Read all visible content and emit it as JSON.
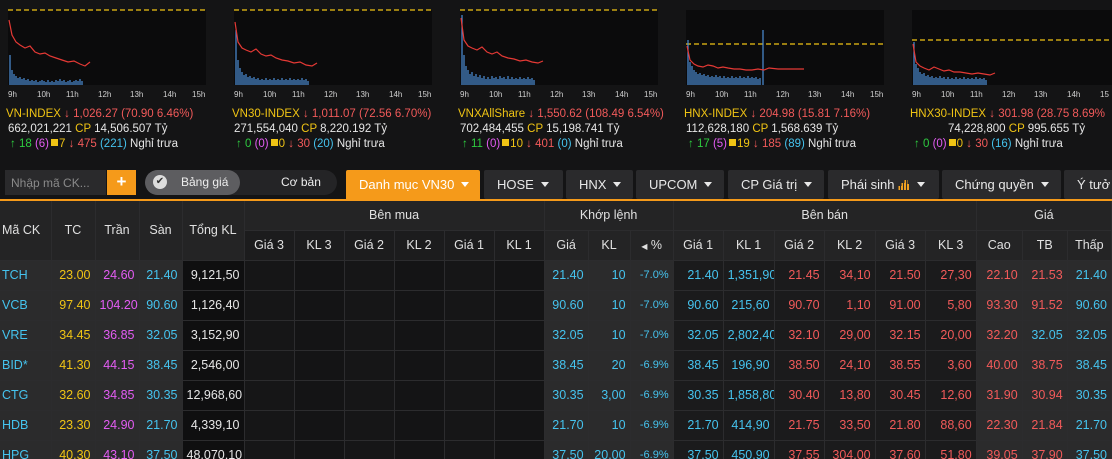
{
  "indices": [
    {
      "name": "VN-INDEX",
      "value": "1,026.27",
      "change": "(70.90 6.46%)",
      "vol": "662,021,221",
      "cp_label": "CP",
      "cp_value": "14,506.507 Tỷ",
      "up": "18",
      "up_ceil": "(6)",
      "ref": "7",
      "down": "475",
      "down_floor": "(221)",
      "status": "Nghỉ trưa"
    },
    {
      "name": "VN30-INDEX",
      "value": "1,011.07",
      "change": "(72.56 6.70%)",
      "vol": "271,554,040",
      "cp_label": "CP",
      "cp_value": "8,220.192 Tỷ",
      "up": "0",
      "up_ceil": "(0)",
      "ref": "0",
      "down": "30",
      "down_floor": "(20)",
      "status": "Nghỉ trưa"
    },
    {
      "name": "VNXAllShare",
      "value": "1,550.62",
      "change": "(108.49 6.54%)",
      "vol": "702,484,455",
      "cp_label": "CP",
      "cp_value": "15,198.741 Tỷ",
      "up": "11",
      "up_ceil": "(0)",
      "ref": "10",
      "down": "401",
      "down_floor": "(0)",
      "status": "Nghỉ trưa"
    },
    {
      "name": "HNX-INDEX",
      "value": "204.98",
      "change": "(15.81 7.16%)",
      "vol": "112,628,180",
      "cp_label": "CP",
      "cp_value": "1,568.639 Tỷ",
      "up": "17",
      "up_ceil": "(5)",
      "ref": "19",
      "down": "185",
      "down_floor": "(89)",
      "status": "Nghỉ trưa"
    },
    {
      "name": "HNX30-INDEX",
      "value": "301.98",
      "change": "(28.75 8.69%",
      "vol": "74,228,800",
      "cp_label": "CP",
      "cp_value": "995.655 Tỷ",
      "up": "0",
      "up_ceil": "(0)",
      "ref": "0",
      "down": "30",
      "down_floor": "(16)",
      "status": "Nghỉ trưa"
    }
  ],
  "chart_axis": [
    "9h",
    "10h",
    "11h",
    "12h",
    "13h",
    "14h",
    "15h"
  ],
  "chart_axis_short": [
    "9h",
    "10h",
    "11h",
    "12h",
    "13h",
    "14h",
    "15"
  ],
  "toolbar": {
    "search_placeholder": "Nhập mã CK...",
    "add_label": "+",
    "toggle_on": "Bảng giá",
    "toggle_off": "Cơ bản",
    "tabs": [
      "Danh mục VN30",
      "HOSE",
      "HNX",
      "UPCOM",
      "CP Giá trị",
      "Phái sinh",
      "Chứng quyền",
      "Ý tưở"
    ]
  },
  "colors": {
    "accent": "#f59a1a",
    "up": "#2ecc40",
    "down": "#f25a5a",
    "ref": "#f0c414",
    "ceil": "#e35cf3",
    "floor": "#45c3ee"
  },
  "table": {
    "groups": {
      "ben_mua": "Bên mua",
      "khop_lenh": "Khớp lệnh",
      "ben_ban": "Bên bán",
      "gia": "Giá"
    },
    "headers": {
      "ma_ck": "Mã CK",
      "tc": "TC",
      "tran": "Trần",
      "san": "Sàn",
      "tong_kl": "Tổng KL",
      "gia3": "Giá 3",
      "kl3": "KL 3",
      "gia2": "Giá 2",
      "kl2": "KL 2",
      "gia1": "Giá 1",
      "kl1": "KL 1",
      "khop_gia": "Giá",
      "khop_kl": "KL",
      "khop_pct": "%",
      "ban_gia1": "Giá 1",
      "ban_kl1": "KL 1",
      "ban_gia2": "Giá 2",
      "ban_kl2": "KL 2",
      "ban_gia3": "Giá 3",
      "ban_kl3": "KL 3",
      "cao": "Cao",
      "tb": "TB",
      "thap": "Thấp"
    },
    "rows": [
      {
        "sym": "TCH",
        "tc": "23.00",
        "tran": "24.60",
        "san": "21.40",
        "tong": "9,121,50",
        "kg": "21.40",
        "kkl": "10",
        "kp": "-7.0%",
        "b1": "21.40",
        "bk1": "1,351,90",
        "b2": "21.45",
        "bk2": "34,10",
        "b3": "21.50",
        "bk3": "27,30",
        "cao": "22.10",
        "tb": "21.53",
        "thap": "21.40",
        "c": {
          "sym": "floor",
          "kg": "floor",
          "b1": "floor",
          "b2": "down",
          "b3": "down",
          "cao": "down",
          "tb": "down",
          "thap": "floor"
        }
      },
      {
        "sym": "VCB",
        "tc": "97.40",
        "tran": "104.20",
        "san": "90.60",
        "tong": "1,126,40",
        "kg": "90.60",
        "kkl": "10",
        "kp": "-7.0%",
        "b1": "90.60",
        "bk1": "215,60",
        "b2": "90.70",
        "bk2": "1,10",
        "b3": "91.00",
        "bk3": "5,80",
        "cao": "93.30",
        "tb": "91.52",
        "thap": "90.60",
        "c": {
          "sym": "floor",
          "kg": "floor",
          "b1": "floor",
          "b2": "down",
          "b3": "down",
          "cao": "down",
          "tb": "down",
          "thap": "floor"
        }
      },
      {
        "sym": "VRE",
        "tc": "34.45",
        "tran": "36.85",
        "san": "32.05",
        "tong": "3,152,90",
        "kg": "32.05",
        "kkl": "10",
        "kp": "-7.0%",
        "b1": "32.05",
        "bk1": "2,802,40",
        "b2": "32.10",
        "bk2": "29,00",
        "b3": "32.15",
        "bk3": "20,00",
        "cao": "32.20",
        "tb": "32.05",
        "thap": "32.05",
        "c": {
          "sym": "floor",
          "kg": "floor",
          "b1": "floor",
          "b2": "down",
          "b3": "down",
          "cao": "down",
          "tb": "floor",
          "thap": "floor"
        }
      },
      {
        "sym": "BID*",
        "tc": "41.30",
        "tran": "44.15",
        "san": "38.45",
        "tong": "2,546,00",
        "kg": "38.45",
        "kkl": "20",
        "kp": "-6.9%",
        "b1": "38.45",
        "bk1": "196,90",
        "b2": "38.50",
        "bk2": "24,10",
        "b3": "38.55",
        "bk3": "3,60",
        "cao": "40.00",
        "tb": "38.75",
        "thap": "38.45",
        "c": {
          "sym": "floor",
          "kg": "floor",
          "b1": "floor",
          "b2": "down",
          "b3": "down",
          "cao": "down",
          "tb": "down",
          "thap": "floor"
        }
      },
      {
        "sym": "CTG",
        "tc": "32.60",
        "tran": "34.85",
        "san": "30.35",
        "tong": "12,968,60",
        "kg": "30.35",
        "kkl": "3,00",
        "kp": "-6.9%",
        "b1": "30.35",
        "bk1": "1,858,80",
        "b2": "30.40",
        "bk2": "13,80",
        "b3": "30.45",
        "bk3": "12,60",
        "cao": "31.90",
        "tb": "30.94",
        "thap": "30.35",
        "c": {
          "sym": "floor",
          "kg": "floor",
          "b1": "floor",
          "b2": "down",
          "b3": "down",
          "cao": "down",
          "tb": "down",
          "thap": "floor"
        }
      },
      {
        "sym": "HDB",
        "tc": "23.30",
        "tran": "24.90",
        "san": "21.70",
        "tong": "4,339,10",
        "kg": "21.70",
        "kkl": "10",
        "kp": "-6.9%",
        "b1": "21.70",
        "bk1": "414,90",
        "b2": "21.75",
        "bk2": "33,50",
        "b3": "21.80",
        "bk3": "88,60",
        "cao": "22.30",
        "tb": "21.84",
        "thap": "21.70",
        "c": {
          "sym": "floor",
          "kg": "floor",
          "b1": "floor",
          "b2": "down",
          "b3": "down",
          "cao": "down",
          "tb": "down",
          "thap": "floor"
        }
      },
      {
        "sym": "HPG",
        "tc": "40.30",
        "tran": "43.10",
        "san": "37.50",
        "tong": "48,070,10",
        "kg": "37.50",
        "kkl": "20,00",
        "kp": "-6.9%",
        "b1": "37.50",
        "bk1": "450,90",
        "b2": "37.55",
        "bk2": "304,00",
        "b3": "37.60",
        "bk3": "51,80",
        "cao": "39.05",
        "tb": "37.90",
        "thap": "37.50",
        "c": {
          "sym": "floor",
          "kg": "floor",
          "b1": "floor",
          "b2": "down",
          "b3": "down",
          "cao": "down",
          "tb": "down",
          "thap": "floor"
        }
      }
    ]
  }
}
